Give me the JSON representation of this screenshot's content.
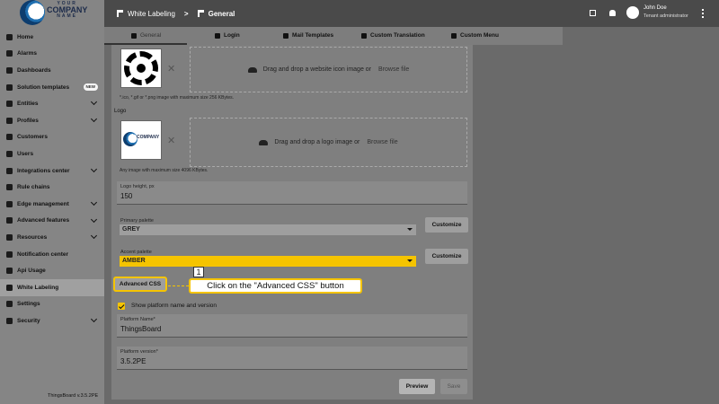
{
  "brand": {
    "line1": "YOUR",
    "line2": "COMPANY",
    "line3": "NAME"
  },
  "sidebar": {
    "items": [
      {
        "label": "Home",
        "icon": "home-icon"
      },
      {
        "label": "Alarms",
        "icon": "alarm-icon"
      },
      {
        "label": "Dashboards",
        "icon": "dashboard-icon"
      },
      {
        "label": "Solution templates",
        "icon": "template-icon",
        "badge": "NEW"
      },
      {
        "label": "Entities",
        "icon": "entities-icon"
      },
      {
        "label": "Profiles",
        "icon": "profiles-icon"
      },
      {
        "label": "Customers",
        "icon": "customers-icon"
      },
      {
        "label": "Users",
        "icon": "users-icon"
      },
      {
        "label": "Integrations center",
        "icon": "integrations-icon"
      },
      {
        "label": "Rule chains",
        "icon": "rule-chain-icon"
      },
      {
        "label": "Edge management",
        "icon": "edge-icon"
      },
      {
        "label": "Advanced features",
        "icon": "advanced-icon"
      },
      {
        "label": "Resources",
        "icon": "resources-icon"
      },
      {
        "label": "Notification center",
        "icon": "notification-icon"
      },
      {
        "label": "Api Usage",
        "icon": "api-usage-icon"
      },
      {
        "label": "White Labeling",
        "icon": "white-label-icon",
        "active": true
      },
      {
        "label": "Settings",
        "icon": "settings-icon"
      },
      {
        "label": "Security",
        "icon": "security-icon"
      }
    ],
    "version": "ThingsBoard v.3.5.2PE"
  },
  "header": {
    "breadcrumb_1": "White Labeling",
    "separator": ">",
    "breadcrumb_2": "General",
    "user_name": "John Doe",
    "user_role": "Tenant administrator"
  },
  "tabs": [
    "General",
    "Login",
    "Mail Templates",
    "Custom Translation",
    "Custom Menu"
  ],
  "form": {
    "icon_dropzone_text": "Drag and drop a website icon image or",
    "browse_label": "Browse file",
    "icon_hint": "*.ico, *.gif or *.png image with maximum size 256 KBytes.",
    "logo_label": "Logo",
    "logo_dropzone_text": "Drag and drop a logo image or",
    "logo_hint": "Any image with maximum size 4096 KBytes.",
    "logo_height_label": "Logo height, px",
    "logo_height_value": "150",
    "primary_palette_label": "Primary palette",
    "primary_palette_value": "GREY",
    "accent_palette_label": "Accent palette",
    "accent_palette_value": "AMBER",
    "customize_label": "Customize",
    "advanced_css_label": "Advanced CSS",
    "show_platform_label": "Show platform name and version",
    "platform_name_label": "Platform Name*",
    "platform_name_value": "ThingsBoard",
    "platform_version_label": "Platform version*",
    "platform_version_value": "3.5.2PE",
    "preview_label": "Preview",
    "save_label": "Save"
  },
  "callout": {
    "step": "1",
    "text": "Click on the \"Advanced CSS\" button"
  },
  "colors": {
    "accent": "#f5c400",
    "primary_grey": "#9e9e9e",
    "header": "#4a4a4a"
  }
}
